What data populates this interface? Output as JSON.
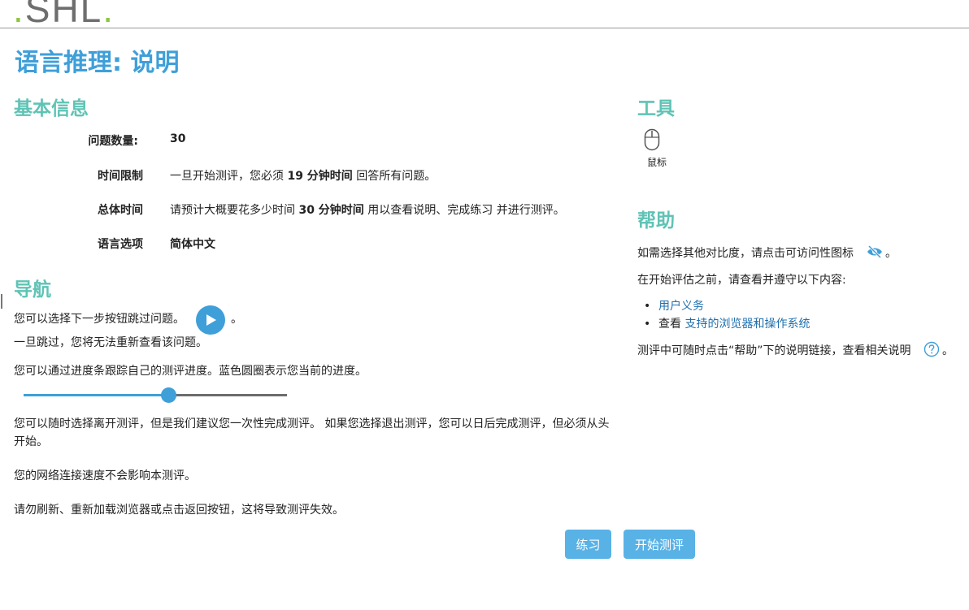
{
  "header": {
    "logo_main": "SHL",
    "logo_dot": "."
  },
  "page_title": "语言推理: 说明",
  "basic_info": {
    "title": "基本信息",
    "rows": [
      {
        "label": "问题数量:",
        "value": "30"
      },
      {
        "label": "时间限制",
        "pre": "一旦开始测评，您必须 ",
        "bold": "19 分钟时间",
        "post": " 回答所有问题。"
      },
      {
        "label": "总体时间",
        "pre": "请预计大概要花多少时间 ",
        "bold": "30 分钟时间",
        "post": " 用以查看说明、完成练习 并进行测评。"
      },
      {
        "label": "语言选项",
        "value": "简体中文"
      }
    ]
  },
  "navigation": {
    "title": "导航",
    "skip_text": "您可以选择下一步按钮跳过问题。",
    "skip_suffix": "。",
    "no_return_text": "一旦跳过，您将无法重新查看该问题。",
    "progress_text": "您可以通过进度条跟踪自己的测评进度。蓝色圆圈表示您当前的进度。",
    "progress_fraction": 0.55,
    "leave_text": "您可以随时选择离开测评，但是我们建议您一次性完成测评。 如果您选择退出测评，您可以日后完成测评，但必须从头开始。",
    "network_text": "您的网络连接速度不会影响本测评。",
    "refresh_text": "请勿刷新、重新加载浏览器或点击返回按钮，这将导致测评失效。"
  },
  "tools": {
    "title": "工具",
    "mouse_label": "鼠标"
  },
  "help": {
    "title": "帮助",
    "contrast_text": "如需选择其他对比度，请点击可访问性图标",
    "contrast_suffix": "。",
    "before_text": "在开始评估之前，请查看并遵守以下内容:",
    "items": [
      {
        "prefix": "",
        "link": "用户义务"
      },
      {
        "prefix": "查看 ",
        "link": "支持的浏览器和操作系统"
      }
    ],
    "help_text": "测评中可随时点击“帮助”下的说明链接，查看相关说明",
    "help_suffix": "。"
  },
  "buttons": {
    "practice": "练习",
    "start": "开始测评"
  },
  "colors": {
    "title_blue": "#3f9fd9",
    "section_teal": "#5fc3b5",
    "button_blue": "#59b2e6",
    "link_blue": "#1f6fae"
  }
}
